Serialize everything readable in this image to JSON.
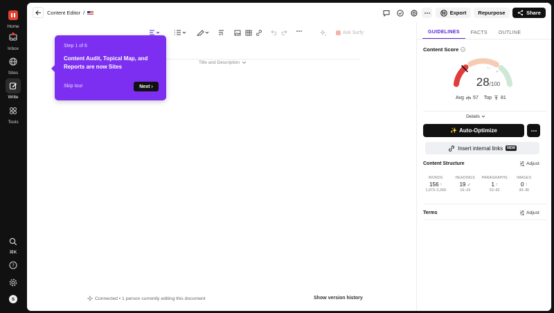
{
  "nav": {
    "items": [
      {
        "label": "Home"
      },
      {
        "label": "Inbox"
      },
      {
        "label": "Sites"
      },
      {
        "label": "Write"
      },
      {
        "label": "Tools"
      }
    ],
    "shortcut": "⌘K",
    "avatar_initial": "S"
  },
  "header": {
    "breadcrumb": "Content Editor",
    "crumb_sep": "/",
    "export_label": "Export",
    "repurpose_label": "Repurpose",
    "share_label": "Share"
  },
  "editor": {
    "ask_surfy": "Ask Surfy",
    "title_description": "Title and Description"
  },
  "tour": {
    "step": "Step 1 of 6",
    "heading": "Content Audit, Topical Map, and Reports are now Sites",
    "skip": "Skip tour",
    "next": "Next ›"
  },
  "footer": {
    "status": "Connected • 1 person currently editing this document",
    "version_history": "Show version history"
  },
  "panel": {
    "tabs": [
      "GUIDELINES",
      "FACTS",
      "OUTLINE"
    ],
    "score_title": "Content Score",
    "score": "28",
    "score_max": "/100",
    "score_fraction": 0.28,
    "avg_label": "Avg",
    "avg_value": "57",
    "top_label": "Top",
    "top_value": "81",
    "details": "Details",
    "auto_optimize": "Auto-Optimize",
    "insert_links": "Insert internal links",
    "new_badge": "NEW",
    "structure_title": "Content Structure",
    "adjust": "Adjust",
    "stats": [
      {
        "key": "WORDS",
        "value": "156",
        "range": "1,973–2,269",
        "indicator": "↑"
      },
      {
        "key": "HEADINGS",
        "value": "19",
        "range": "16–19",
        "indicator": "✓"
      },
      {
        "key": "PARAGRAPHS",
        "value": "1",
        "range": "52–62",
        "indicator": "↑"
      },
      {
        "key": "IMAGES",
        "value": "0",
        "range": "30–36",
        "indicator": "↑"
      }
    ],
    "terms_title": "Terms"
  },
  "colors": {
    "accent": "#7c2ff0",
    "tab_active": "#5b21d6",
    "gauge_red": "#e23b3b",
    "gauge_peach": "#f6cdb4",
    "gauge_green": "#cfe8d6"
  }
}
